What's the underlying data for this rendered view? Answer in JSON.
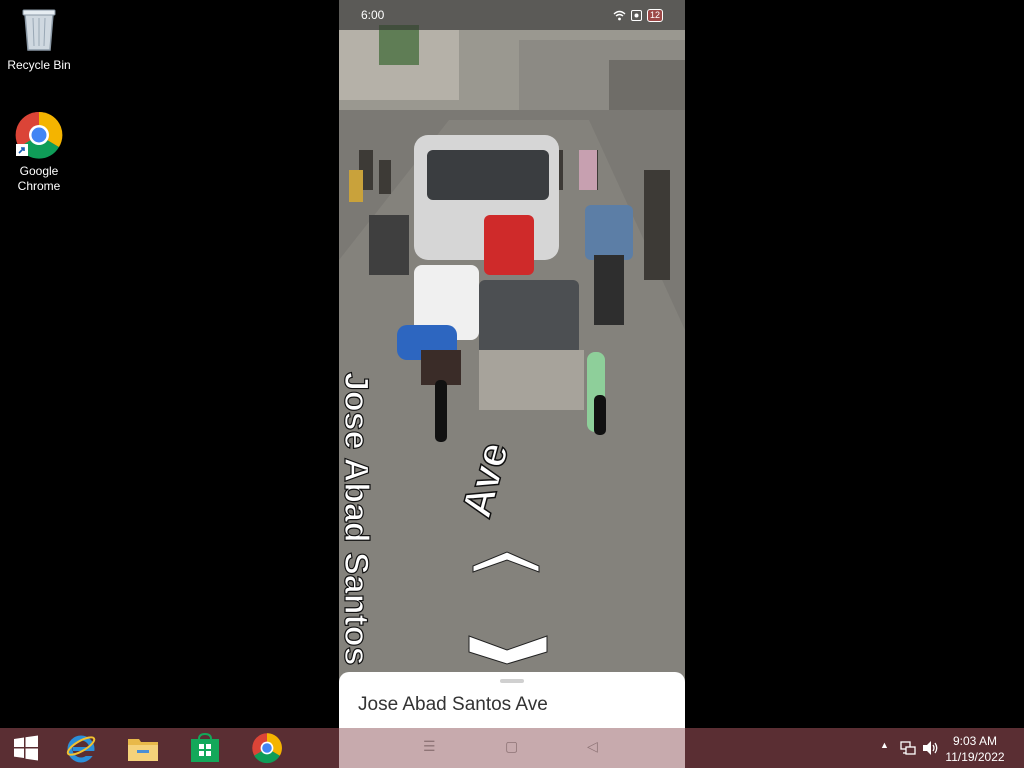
{
  "desktop": {
    "icons": [
      {
        "label": "Recycle Bin",
        "icon": "recycle-bin-icon"
      },
      {
        "label": "Google\nChrome",
        "icon": "chrome-icon"
      }
    ]
  },
  "phone": {
    "status": {
      "time": "6:00",
      "battery": "12"
    },
    "street_labels": {
      "left": "Jose Abad Santos",
      "right": "Ave"
    },
    "sheet": {
      "title": "Jose Abad Santos Ave"
    }
  },
  "taskbar": {
    "apps": [
      "windows-start-icon",
      "internet-explorer-icon",
      "file-explorer-icon",
      "store-icon",
      "chrome-icon"
    ],
    "clock": {
      "time": "9:03 AM",
      "date": "11/19/2022"
    }
  },
  "colors": {
    "taskbar": "#5a2e33",
    "nav_bar": "#c7aaad",
    "road": "#7d7b76"
  }
}
